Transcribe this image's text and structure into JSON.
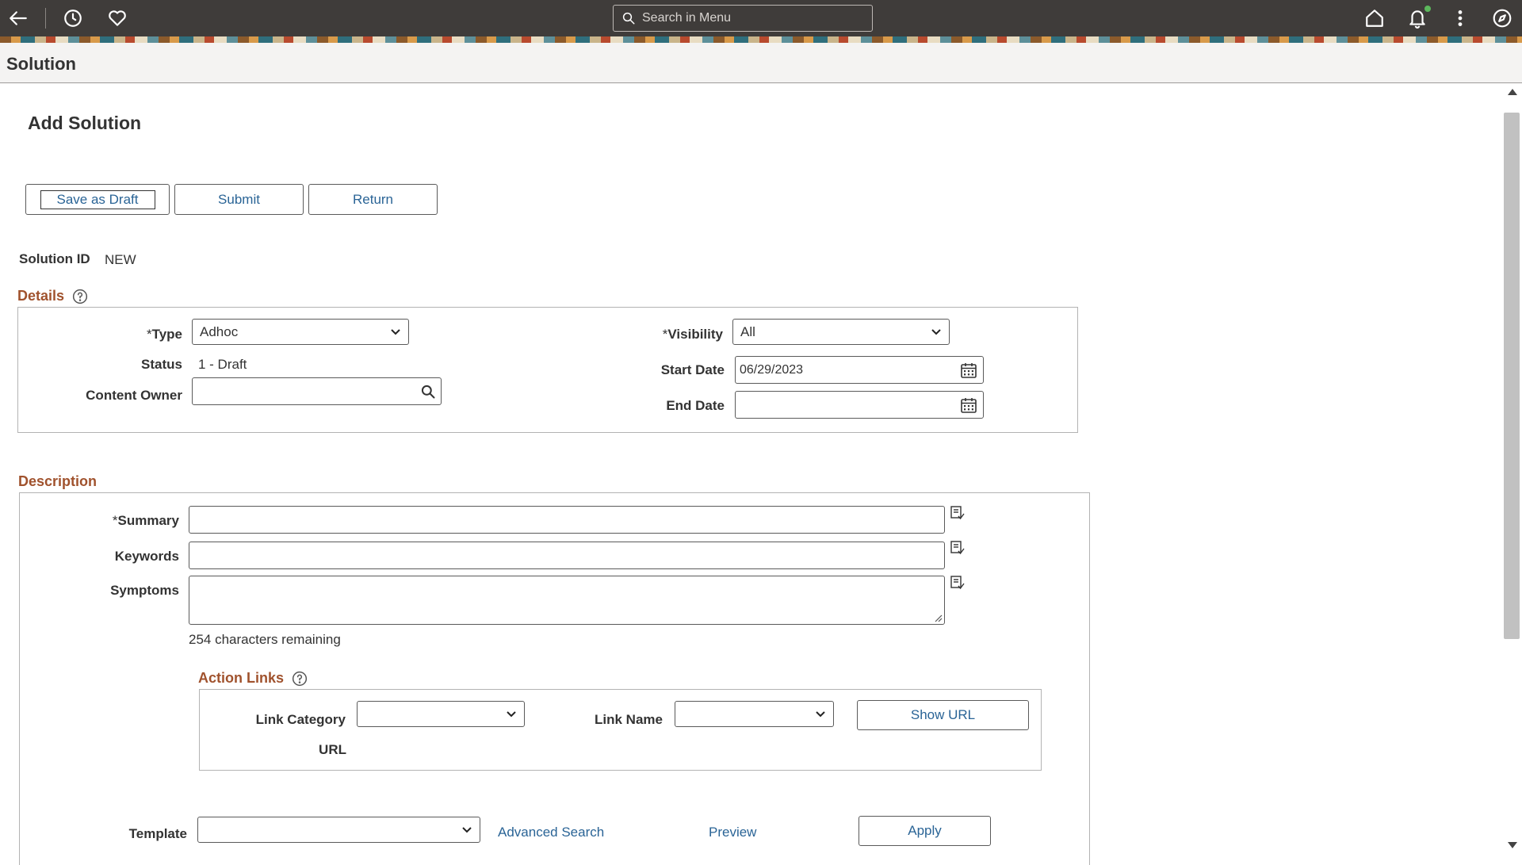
{
  "topbar": {
    "icons": [
      "back-arrow-icon",
      "history-icon",
      "heart-icon",
      "home-icon",
      "bell-icon",
      "kebab-menu-icon",
      "compass-icon"
    ],
    "search_placeholder": "Search in Menu"
  },
  "page": {
    "title": "Solution",
    "subtitle": "Add Solution"
  },
  "toolbar": {
    "save_draft": "Save as Draft",
    "submit": "Submit",
    "return": "Return"
  },
  "solution": {
    "id_label": "Solution ID",
    "id_value": "NEW"
  },
  "details": {
    "heading": "Details",
    "type_label": "Type",
    "type_value": "Adhoc",
    "status_label": "Status",
    "status_value": "1 - Draft",
    "owner_label": "Content Owner",
    "owner_value": "",
    "visibility_label": "Visibility",
    "visibility_value": "All",
    "start_label": "Start Date",
    "start_value": "06/29/2023",
    "end_label": "End Date",
    "end_value": ""
  },
  "description": {
    "heading": "Description",
    "summary_label": "Summary",
    "summary_value": "",
    "keywords_label": "Keywords",
    "keywords_value": "",
    "symptoms_label": "Symptoms",
    "symptoms_value": "",
    "chars_remaining": "254 characters remaining"
  },
  "action_links": {
    "heading": "Action Links",
    "category_label": "Link Category",
    "category_value": "",
    "name_label": "Link Name",
    "name_value": "",
    "show_url": "Show URL",
    "url_label": "URL"
  },
  "template": {
    "label": "Template",
    "value": "",
    "advanced_search": "Advanced Search",
    "preview": "Preview",
    "apply": "Apply"
  },
  "colors": {
    "topbar": "#3f3c3a",
    "section_heading": "#a0522d",
    "link": "#2a6496",
    "notification_dot": "#5cb85c"
  }
}
